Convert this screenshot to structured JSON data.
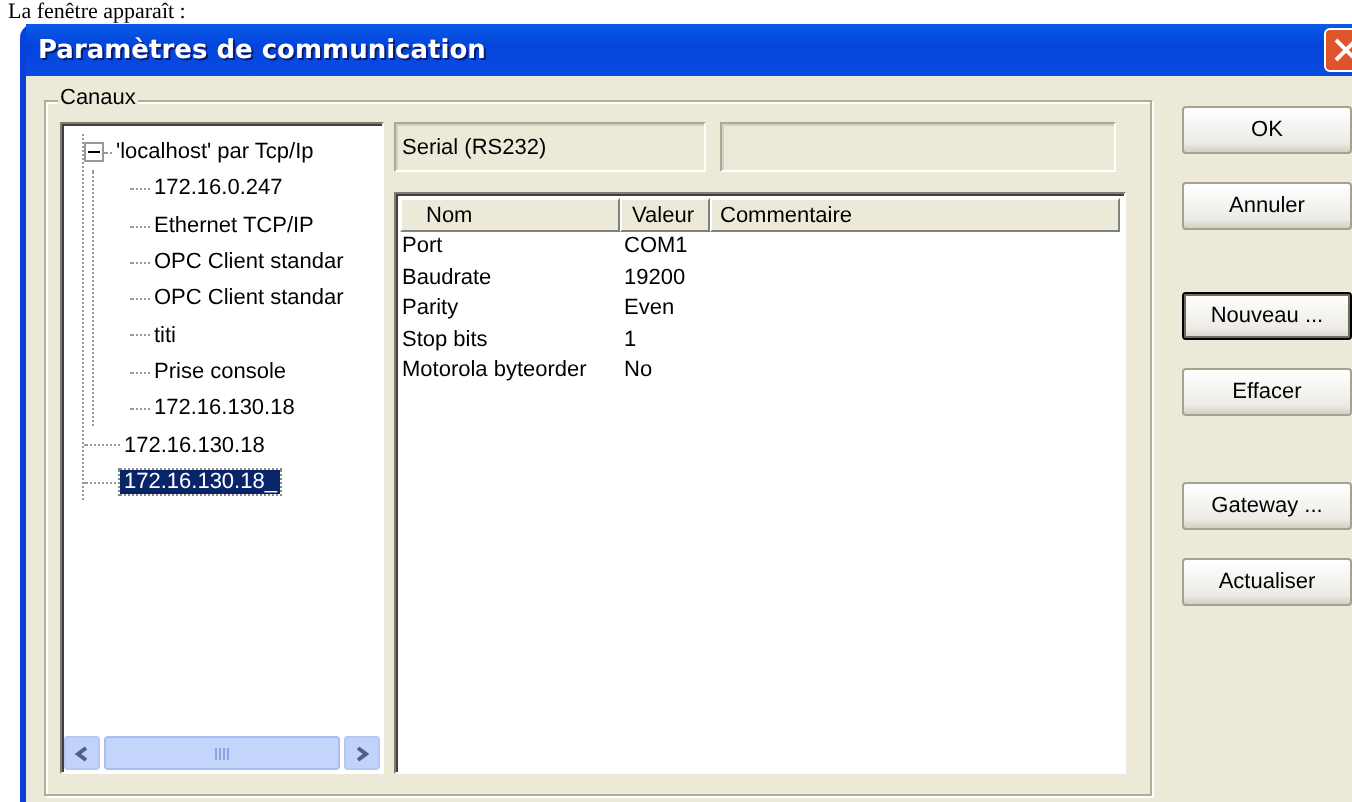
{
  "caption": "La fenêtre apparaît :",
  "window": {
    "title": "Paramètres de communication"
  },
  "group": {
    "label": "Canaux"
  },
  "tree": [
    {
      "label": "'localhost' par Tcp/Ip",
      "expanded": true,
      "selected": false,
      "children": [
        {
          "label": "172.16.0.247",
          "selected": false
        },
        {
          "label": "Ethernet TCP/IP",
          "selected": false
        },
        {
          "label": "OPC Client standar",
          "selected": false
        },
        {
          "label": "OPC Client standar",
          "selected": false
        },
        {
          "label": "titi",
          "selected": false
        },
        {
          "label": "Prise console",
          "selected": false
        },
        {
          "label": "172.16.130.18",
          "selected": false
        }
      ]
    },
    {
      "label": "172.16.130.18",
      "selected": false
    },
    {
      "label": "172.16.130.18_",
      "selected": true
    }
  ],
  "channel_type": "Serial (RS232)",
  "table": {
    "columns": [
      "Nom",
      "Valeur",
      "Commentaire"
    ],
    "rows": [
      [
        "Port",
        "COM1",
        ""
      ],
      [
        "Baudrate",
        "19200",
        ""
      ],
      [
        "Parity",
        "Even",
        ""
      ],
      [
        "Stop bits",
        "1",
        ""
      ],
      [
        "Motorola byteorder",
        "No",
        ""
      ]
    ]
  },
  "buttons": [
    {
      "label": "OK",
      "default": false
    },
    {
      "label": "Annuler",
      "default": false
    },
    {
      "label": "Nouveau ...",
      "default": true
    },
    {
      "label": "Effacer",
      "default": false
    },
    {
      "label": "Gateway ...",
      "default": false
    },
    {
      "label": "Actualiser",
      "default": false
    }
  ]
}
